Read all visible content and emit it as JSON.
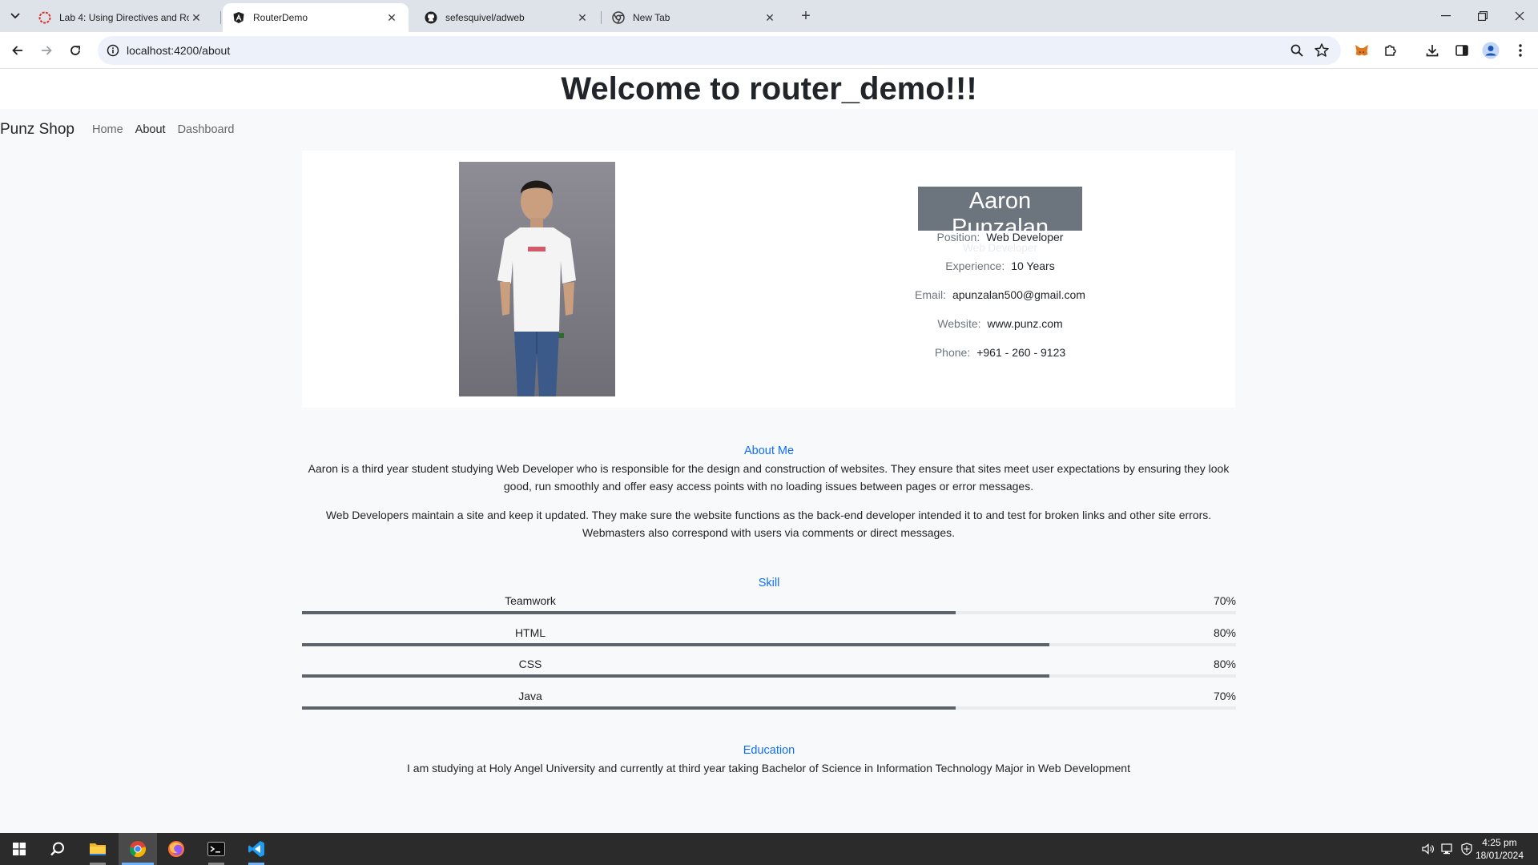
{
  "browser": {
    "tabs": [
      {
        "title": "Lab 4: Using Directives and Rou",
        "icon": "lab-favicon-icon",
        "active": false
      },
      {
        "title": "RouterDemo",
        "icon": "angular-icon",
        "active": true
      },
      {
        "title": "sefesquivel/adweb",
        "icon": "github-icon",
        "active": false
      },
      {
        "title": "New Tab",
        "icon": "chrome-icon",
        "active": false
      }
    ],
    "url": "localhost:4200/about"
  },
  "page": {
    "heading": "Welcome to router_demo!!!",
    "navbar": {
      "brand": "Punz Shop",
      "links": [
        "Home",
        "About",
        "Dashboard"
      ]
    },
    "profile": {
      "name": "Aaron Punzalan",
      "role": "Web Developer",
      "fields": [
        {
          "label": "Position:",
          "value": "Web Developer"
        },
        {
          "label": "Experience:",
          "value": "10 Years"
        },
        {
          "label": "Email:",
          "value": "apunzalan500@gmail.com"
        },
        {
          "label": "Website:",
          "value": "www.punz.com"
        },
        {
          "label": "Phone:",
          "value": "+961 - 260 - 9123"
        }
      ]
    },
    "about": {
      "title": "About Me",
      "paragraphs": [
        "Aaron is a third year student studying Web Developer who is responsible for the design and construction of websites. They ensure that sites meet user expectations by ensuring they look good, run smoothly and offer easy access points with no loading issues between pages or error messages.",
        "Web Developers maintain a site and keep it updated. They make sure the website functions as the back-end developer intended it to and test for broken links and other site errors. Webmasters also correspond with users via comments or direct messages."
      ]
    },
    "skills": {
      "title": "Skill",
      "items": [
        {
          "name": "Teamwork",
          "percent_label": "70%",
          "level": 0.7
        },
        {
          "name": "HTML",
          "percent_label": "80%",
          "level": 0.8
        },
        {
          "name": "CSS",
          "percent_label": "80%",
          "level": 0.8
        },
        {
          "name": "Java",
          "percent_label": "70%",
          "level": 0.7
        }
      ]
    },
    "education": {
      "title": "Education",
      "text": "I am studying at Holy Angel University and currently at third year taking Bachelor of Science in Information Technology Major in Web Development"
    }
  },
  "taskbar": {
    "time": "4:25 pm",
    "date": "18/01/2024"
  },
  "colors": {
    "accent": "#0d6efd",
    "name_badge": "#6c757d",
    "progress_fill": "#5c636a"
  }
}
